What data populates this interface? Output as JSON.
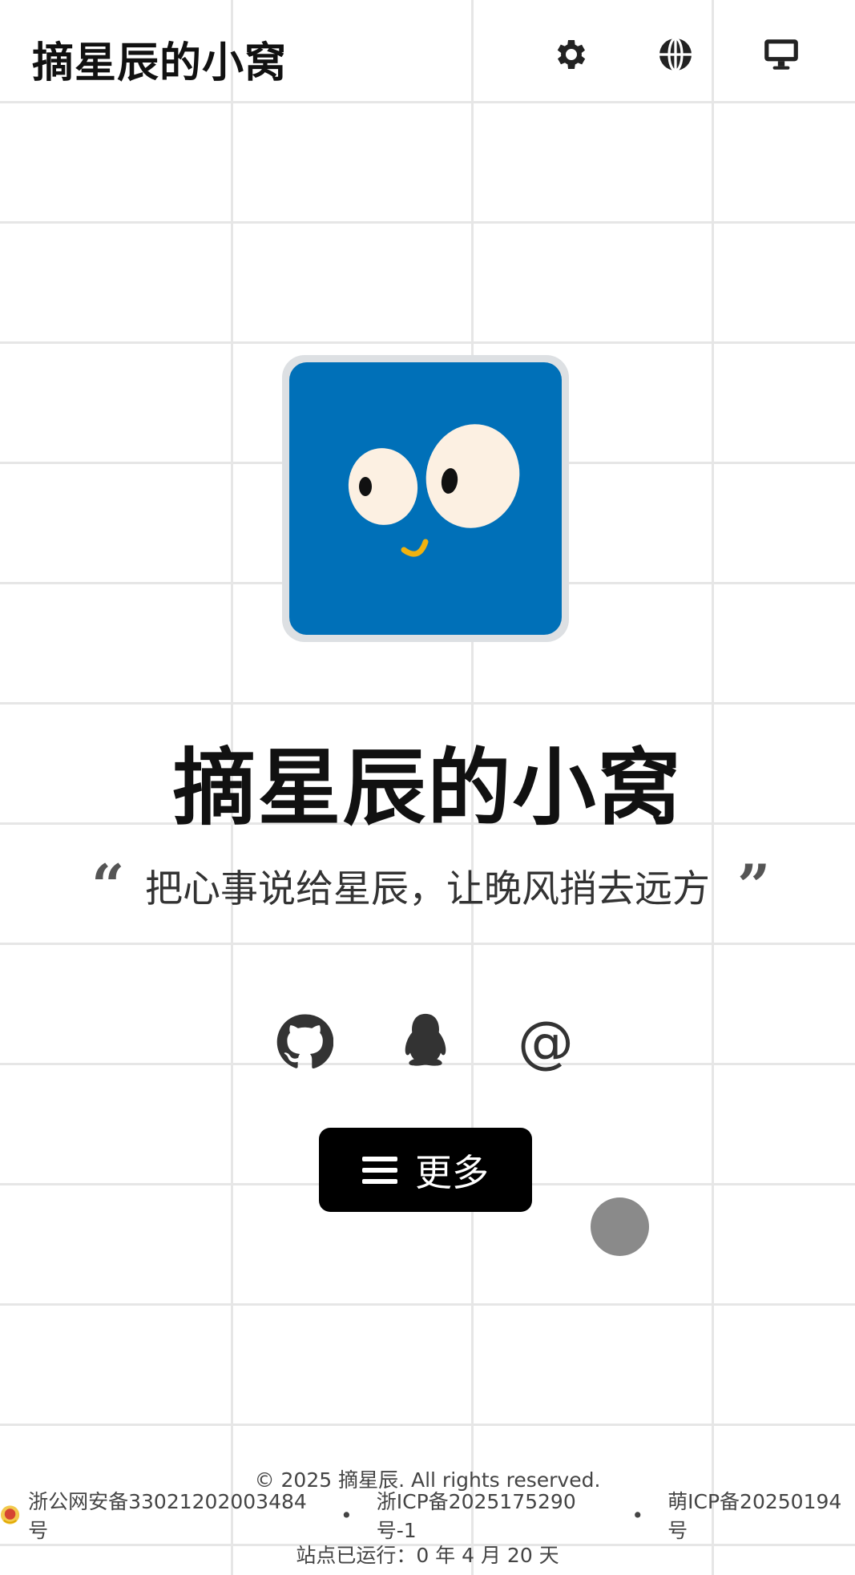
{
  "header": {
    "title": "摘星辰的小窝",
    "icons": [
      "gear-icon",
      "globe-icon",
      "monitor-icon"
    ]
  },
  "hero": {
    "avatar_icon": "cartoon-face-avatar",
    "title": "摘星辰的小窝",
    "quote_open": "“",
    "motto": "把心事说给星辰，让晚风捎去远方",
    "quote_close": "”"
  },
  "social": {
    "icons": [
      "github-icon",
      "qq-icon",
      "email-icon"
    ],
    "email_symbol": "@"
  },
  "more_button": {
    "icon": "menu-icon",
    "label": "更多"
  },
  "footer": {
    "copyright": "© 2025 摘星辰. All rights reserved.",
    "police_beian": "浙公网安备33021202003484号",
    "separator": "•",
    "icp_beian": "浙ICP备2025175290号-1",
    "moe_icp": "萌ICP备20250194号",
    "uptime": "站点已运行：0 年 4 月 20 天"
  },
  "colors": {
    "background": "#ffffff",
    "grid_line": "#e6e6e6",
    "avatar_blue": "#0070b8",
    "button_bg": "#000000",
    "floating_dot": "#8a8a8a"
  }
}
